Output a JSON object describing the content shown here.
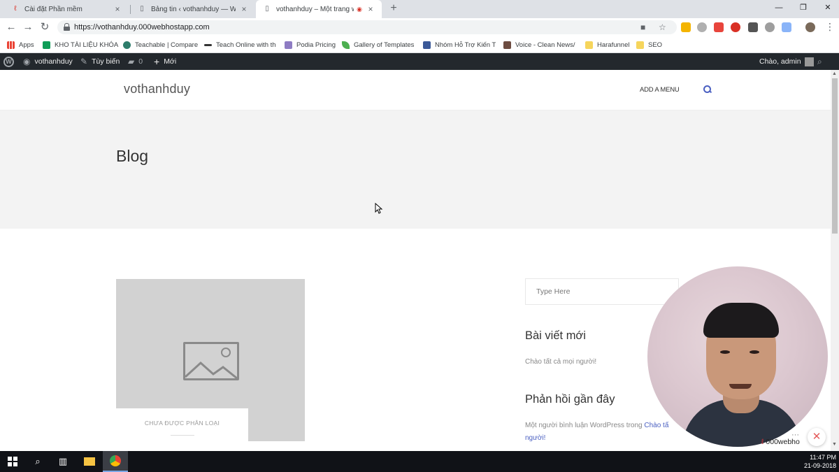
{
  "browser": {
    "tabs": [
      {
        "title": "Cài đặt Phần mềm",
        "icon": "red-swirl-icon"
      },
      {
        "title": "Bảng tin ‹ vothanhduy — WordPress",
        "icon": "page-icon"
      },
      {
        "title": "vothanhduy – Một trang web",
        "icon": "page-icon"
      }
    ],
    "new_tab": "+",
    "url": "https://vothanhduy.000webhostapp.com",
    "bookmarks": [
      {
        "label": "Apps",
        "color": "#ea4335"
      },
      {
        "label": "KHO TÀI LIỆU KHÓA",
        "color": "#0f9d58"
      },
      {
        "label": "Teachable | Compare",
        "color": "#2e7d6b"
      },
      {
        "label": "Teach Online with th",
        "color": "#333333"
      },
      {
        "label": "Podia Pricing",
        "color": "#8e7cc3"
      },
      {
        "label": "Gallery of Templates",
        "color": "#4caf50"
      },
      {
        "label": "Nhóm Hỗ Trợ Kiến T",
        "color": "#3b5998"
      },
      {
        "label": "Voice - Clean News/",
        "color": "#6d4c41"
      },
      {
        "label": "Harafunnel",
        "color": "#f6d55c"
      },
      {
        "label": "SEO",
        "color": "#f6d55c"
      }
    ]
  },
  "adminbar": {
    "site_name": "vothanhduy",
    "customize": "Tùy biến",
    "comments_count": "0",
    "new": "Mới",
    "greeting": "Chào, admin"
  },
  "site": {
    "title": "vothanhduy",
    "menu_link": "ADD A MENU",
    "hero_title": "Blog",
    "post_category": "CHƯA ĐƯỢC PHÂN LOẠI",
    "search_placeholder": "Type Here",
    "recent_posts_title": "Bài viết mới",
    "recent_post_1": "Chào tất cả mọi người!",
    "recent_comments_title": "Phản hồi gần đây",
    "comment_prefix": "Một người bình luận WordPress trong ",
    "comment_link_1": "Chào tấ",
    "comment_link_2": "người!"
  },
  "overlay": {
    "badge": "000webho",
    "more": "···",
    "close": "✕"
  },
  "taskbar": {
    "time": "11:47 PM",
    "date": "21-09-2018"
  }
}
